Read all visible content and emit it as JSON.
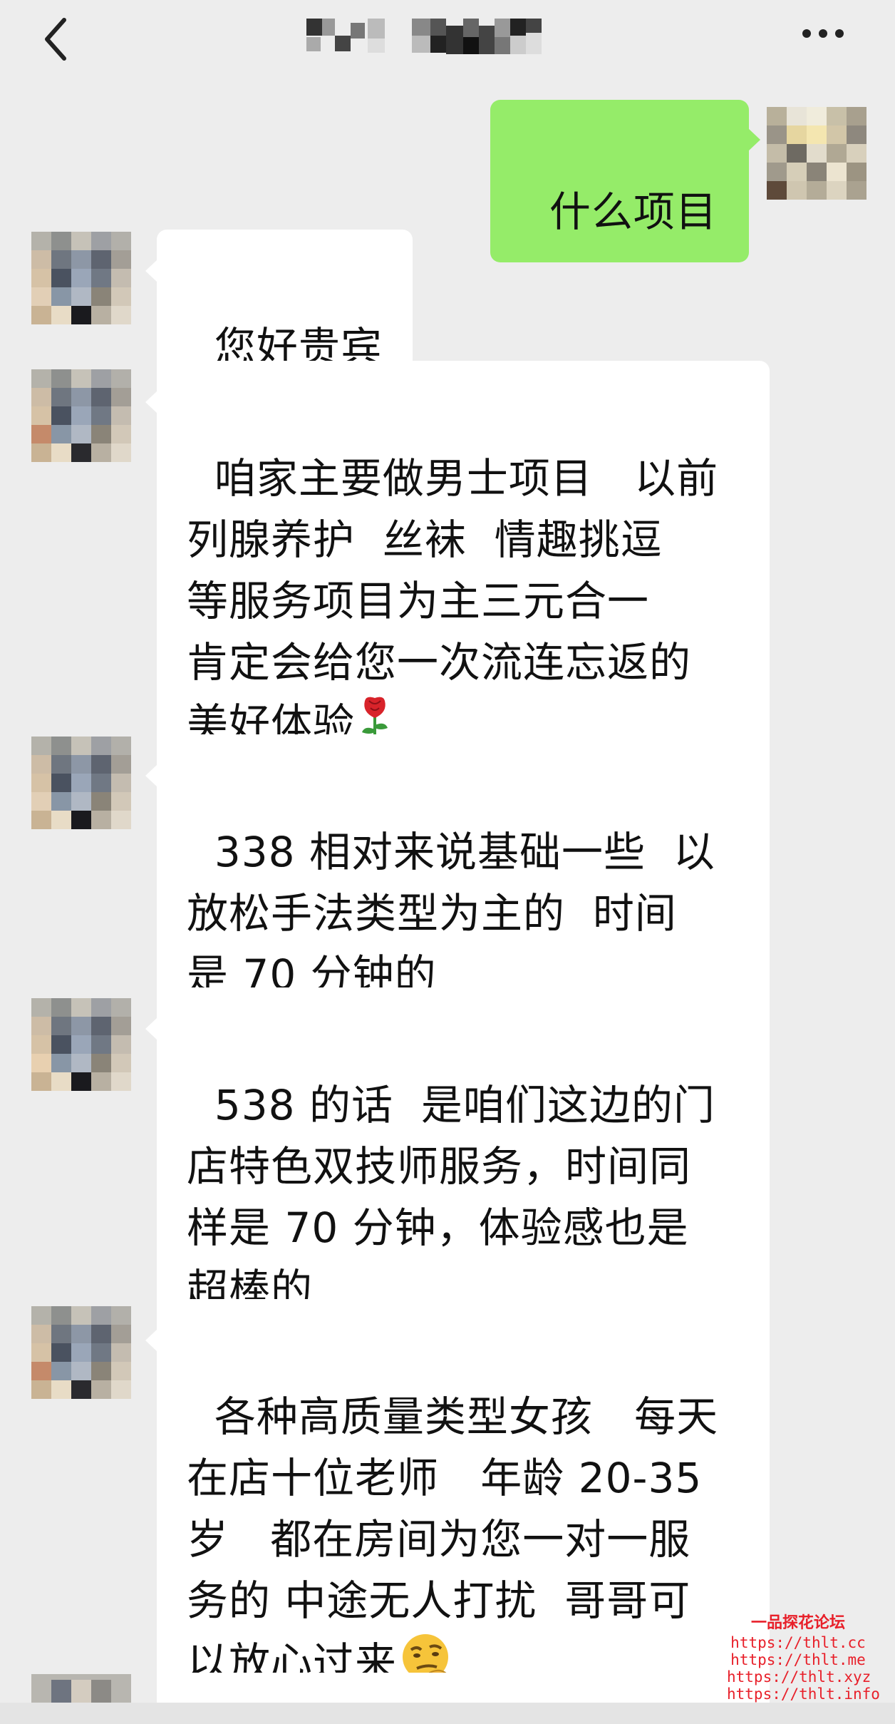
{
  "header": {
    "title_hidden": true,
    "back_icon": "chevron-left-icon",
    "more_icon": "more-horizontal-icon"
  },
  "messages": [
    {
      "side": "sent",
      "text": "什么项目"
    },
    {
      "side": "received",
      "text": "您好贵宾"
    },
    {
      "side": "received",
      "text": "咱家主要做男士项目   以前\n列腺养护  丝袜  情趣挑逗\n等服务项目为主三元合一\n肯定会给您一次流连忘返的\n美好体验",
      "emoji": "rose-icon"
    },
    {
      "side": "received",
      "text": "338 相对来说基础一些  以\n放松手法类型为主的  时间\n是 70 分钟的"
    },
    {
      "side": "received",
      "text": "538 的话  是咱们这边的门\n店特色双技师服务，时间同\n样是 70 分钟，体验感也是\n超棒的"
    },
    {
      "side": "received",
      "text": "各种高质量类型女孩   每天\n在店十位老师   年龄 20-35\n岁   都在房间为您一对一服\n务的 中途无人打扰  哥哥可\n以放心过来",
      "emoji": "smirk-emoji-icon"
    }
  ],
  "watermark": {
    "title": "一品探花论坛",
    "urls": [
      "https://thlt.cc",
      "https://thlt.me",
      "https://thlt.xyz",
      "https://thlt.info"
    ]
  },
  "colors": {
    "background": "#ededed",
    "sent_bubble": "#95ec69",
    "received_bubble": "#ffffff",
    "watermark": "#e8202a"
  }
}
